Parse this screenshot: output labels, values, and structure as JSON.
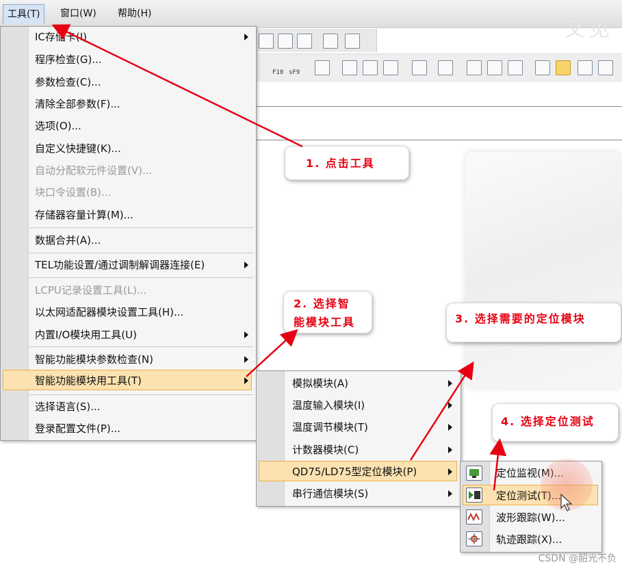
{
  "menubar": {
    "tools": "工具(T)",
    "window": "窗口(W)",
    "help": "帮助(H)",
    "watermark": "又见"
  },
  "toolbar": {
    "f10": "F10",
    "sf9": "sF9"
  },
  "tools_menu": {
    "items": [
      {
        "label": "IC存储卡(I)",
        "disabled": false,
        "submenu": true
      },
      {
        "label": "程序检查(G)...",
        "disabled": false,
        "submenu": false
      },
      {
        "label": "参数检查(C)...",
        "disabled": false,
        "submenu": false
      },
      {
        "label": "清除全部参数(F)...",
        "disabled": false,
        "submenu": false
      },
      {
        "label": "选项(O)...",
        "disabled": false,
        "submenu": false
      },
      {
        "label": "自定义快捷键(K)...",
        "disabled": false,
        "submenu": false
      },
      {
        "label": "自动分配软元件设置(V)...",
        "disabled": true,
        "submenu": false
      },
      {
        "label": "块口令设置(B)...",
        "disabled": true,
        "submenu": false
      },
      {
        "label": "存储器容量计算(M)...",
        "disabled": false,
        "submenu": false
      },
      {
        "label": "数据合并(A)...",
        "disabled": false,
        "submenu": false
      },
      {
        "label": "TEL功能设置/通过调制解调器连接(E)",
        "disabled": false,
        "submenu": true
      },
      {
        "label": "LCPU记录设置工具(L)...",
        "disabled": true,
        "submenu": false
      },
      {
        "label": "以太网适配器模块设置工具(H)...",
        "disabled": false,
        "submenu": false
      },
      {
        "label": "内置I/O模块用工具(U)",
        "disabled": false,
        "submenu": true
      },
      {
        "label": "智能功能模块参数检查(N)",
        "disabled": false,
        "submenu": true
      },
      {
        "label": "智能功能模块用工具(T)",
        "disabled": false,
        "submenu": true,
        "selected": true
      },
      {
        "label": "选择语言(S)...",
        "disabled": false,
        "submenu": false
      },
      {
        "label": "登录配置文件(P)...",
        "disabled": false,
        "submenu": false
      }
    ]
  },
  "intelligent_menu": {
    "items": [
      {
        "label": "模拟模块(A)"
      },
      {
        "label": "温度输入模块(I)"
      },
      {
        "label": "温度调节模块(T)"
      },
      {
        "label": "计数器模块(C)"
      },
      {
        "label": "QD75/LD75型定位模块(P)",
        "selected": true
      },
      {
        "label": "串行通信模块(S)"
      }
    ]
  },
  "positioning_menu": {
    "items": [
      {
        "label": "定位监视(M)...",
        "icon": "monitor-icon"
      },
      {
        "label": "定位测试(T)...",
        "icon": "test-icon",
        "selected": true
      },
      {
        "label": "波形跟踪(W)...",
        "icon": "waveform-icon"
      },
      {
        "label": "轨迹跟踪(X)...",
        "icon": "trajectory-icon"
      }
    ]
  },
  "callouts": {
    "step1": "1. 点击工具",
    "step2a": "2. 选择智",
    "step2b": "能模块工具",
    "step3": "3. 选择需要的定位模块",
    "step4": "4. 选择定位测试"
  },
  "footer": {
    "csdn": "CSDN @韶光不负"
  },
  "colors": {
    "annotation": "#e60012",
    "selected": "#fbe2b0",
    "menu_bg": "#f5f5f5"
  }
}
